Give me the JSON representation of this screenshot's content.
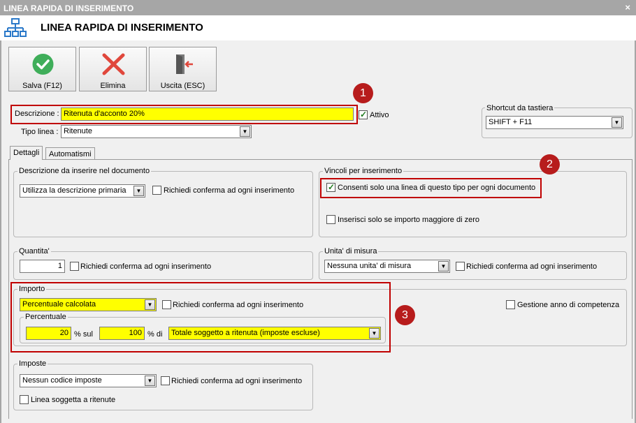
{
  "window": {
    "title": "LINEA RAPIDA DI INSERIMENTO",
    "header_title": "LINEA RAPIDA DI INSERIMENTO",
    "close_glyph": "×"
  },
  "toolbar": {
    "save_label": "Salva (F12)",
    "delete_label": "Elimina",
    "exit_label": "Uscita (ESC)"
  },
  "form": {
    "descrizione_label": "Descrizione :",
    "descrizione_value": "Ritenuta d'acconto 20%",
    "attivo_label": "Attivo",
    "attivo_checked": true,
    "tipo_linea_label": "Tipo linea :",
    "tipo_linea_value": "Ritenute"
  },
  "shortcut": {
    "legend": "Shortcut da tastiera",
    "value": "SHIFT + F11"
  },
  "tabs": [
    "Dettagli",
    "Automatismi"
  ],
  "descrizione_doc": {
    "legend": "Descrizione da inserire nel documento",
    "select_value": "Utilizza la descrizione primaria",
    "confirm_label": "Richiedi conferma ad ogni inserimento"
  },
  "vincoli": {
    "legend": "Vincoli per inserimento",
    "one_line_label": "Consenti solo una linea di questo tipo per ogni documento",
    "one_line_checked": true,
    "only_positive_label": "Inserisci solo se importo maggiore di zero"
  },
  "quantita": {
    "legend": "Quantita'",
    "value": "1",
    "confirm_label": "Richiedi conferma ad ogni inserimento"
  },
  "unita": {
    "legend": "Unita' di misura",
    "select_value": "Nessuna unita' di misura",
    "confirm_label": "Richiedi conferma ad ogni inserimento"
  },
  "importo": {
    "legend": "Importo",
    "select_value": "Percentuale calcolata",
    "confirm_label": "Richiedi conferma ad ogni inserimento",
    "competenza_label": "Gestione anno di competenza"
  },
  "percentuale": {
    "legend": "Percentuale",
    "pct_value": "20",
    "pct_sul_label": "% sul",
    "base_value": "100",
    "pct_di_label": "% di",
    "target_value": "Totale soggetto a ritenuta (imposte escluse)"
  },
  "imposte": {
    "legend": "Imposte",
    "select_value": "Nessun codice imposte",
    "confirm_label": "Richiedi conferma ad ogni inserimento",
    "ritenute_label": "Linea soggetta a ritenute"
  },
  "annotations": [
    "1",
    "2",
    "3"
  ],
  "colors": {
    "highlight": "#ffff00",
    "annotation_red": "#c00000",
    "save_green": "#3fae5a",
    "delete_red": "#e0473c"
  }
}
